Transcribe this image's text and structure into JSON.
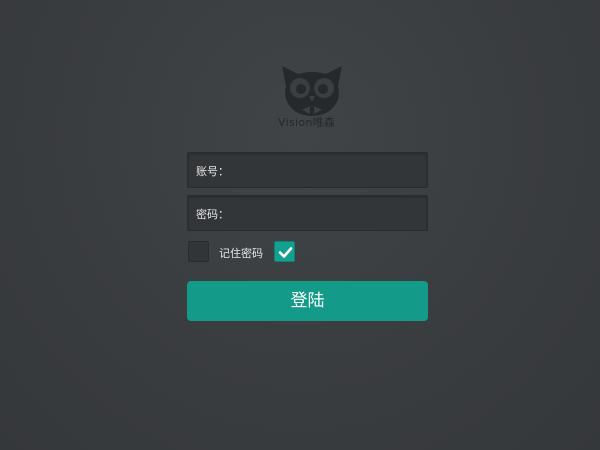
{
  "logo": {
    "icon": "owl-logo-icon",
    "text": "Vision唯森"
  },
  "form": {
    "account_label": "账号：",
    "account_value": "",
    "password_label": "密码：",
    "password_value": "",
    "remember_checked": false,
    "remember_label": "记住密码",
    "confirm_checked": true,
    "login_label": "登陆"
  },
  "colors": {
    "background": "#3b3e41",
    "accent": "#139a89",
    "field": "#333639",
    "text": "#e6e6e6"
  }
}
